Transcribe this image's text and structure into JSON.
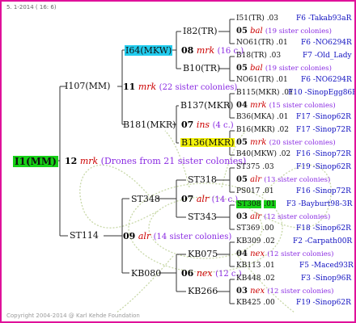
{
  "header": "5. 1-2014 ( 16: 6)",
  "copyright": "Copyright 2004-2014 @ Karl Kehde Foundation",
  "root": {
    "label": "I1(MM)",
    "bg": "#17d117"
  },
  "gen1": {
    "num": "12",
    "mrk": "mrk",
    "note": "(Drones from 21 sister colonies)"
  },
  "p1": {
    "label": "I107(MM)",
    "num": "11",
    "mrk": "mrk",
    "note": "(22 sister colonies)"
  },
  "p2": {
    "label": "ST114",
    "num": "09",
    "mrk": "alr",
    "note": "(14 sister colonies)"
  },
  "p1a": {
    "label": "I64(MKW)",
    "num": "08",
    "mrk": "mrk",
    "note": "(16 c.)",
    "bg": "#22ccee"
  },
  "p1b": {
    "label": "B181(MKR)",
    "num": "07",
    "mrk": "ins",
    "note": "(4 c.)"
  },
  "p2a": {
    "label": "ST348",
    "num": "07",
    "mrk": "alr",
    "note": "(14 c.)"
  },
  "p2b": {
    "label": "KB080",
    "num": "06",
    "mrk": "nex",
    "note": "(12 c.)"
  },
  "g3": [
    {
      "label": "I82(TR)"
    },
    {
      "label": "B10(TR)"
    },
    {
      "label": "B137(MKR)"
    },
    {
      "label": "B136(MKR)",
      "bg": "#f2f20a"
    },
    {
      "label": "ST318"
    },
    {
      "label": "ST343"
    },
    {
      "label": "KB075"
    },
    {
      "label": "KB266"
    }
  ],
  "g4": [
    {
      "top": {
        "name": "I51(TR)",
        "val": ".03",
        "code": "F6 -Takab93aR"
      },
      "mid": {
        "num": "05",
        "mrk": "bal",
        "note": "(19 sister colonies)"
      },
      "bot": {
        "name": "NO61(TR)",
        "val": ".01",
        "code": "F6 -NO6294R"
      }
    },
    {
      "top": {
        "name": "B18(TR)",
        "val": ".03",
        "code": "F7 -Old_Lady"
      },
      "mid": {
        "num": "05",
        "mrk": "bal",
        "note": "(19 sister colonies)"
      },
      "bot": {
        "name": "NO61(TR)",
        "val": ".01",
        "code": "F6 -NO6294R"
      }
    },
    {
      "top": {
        "name": "B115(MKR)",
        "val": ".01",
        "code": "F10 -SinopEgg86R"
      },
      "mid": {
        "num": "04",
        "mrk": "mrk",
        "note": "(15 sister colonies)"
      },
      "bot": {
        "name": "B36(MKA)",
        "val": ".01",
        "code": "F17 -Sinop62R"
      }
    },
    {
      "top": {
        "name": "B16(MKR)",
        "val": ".02",
        "code": "F17 -Sinop72R"
      },
      "mid": {
        "num": "05",
        "mrk": "mrk",
        "note": "(20 sister colonies)"
      },
      "bot": {
        "name": "B40(MKW)",
        "val": ".02",
        "code": "F16 -Sinop72R"
      }
    },
    {
      "top": {
        "name": "ST375",
        "val": ".03",
        "code": "F19 -Sinop62R"
      },
      "mid": {
        "num": "05",
        "mrk": "alr",
        "note": "(13 sister colonies)"
      },
      "bot": {
        "name": "PS017",
        "val": ".01",
        "code": "F16 -Sinop72R"
      }
    },
    {
      "top": {
        "name": "ST308",
        "val": ".01",
        "code": "F3 -Bayburt98-3R",
        "bg": "#17d117"
      },
      "mid": {
        "num": "03",
        "mrk": "alr",
        "note": "(12 sister colonies)"
      },
      "bot": {
        "name": "ST369",
        "val": ".00",
        "code": "F18 -Sinop62R"
      }
    },
    {
      "top": {
        "name": "KB309",
        "val": ".02",
        "code": "F2 -Carpath00R"
      },
      "mid": {
        "num": "04",
        "mrk": "nex",
        "note": "(12 sister colonies)"
      },
      "bot": {
        "name": "KB113",
        "val": ".01",
        "code": "F5 -Maced93R"
      }
    },
    {
      "top": {
        "name": "KB448",
        "val": ".02",
        "code": "F3 -Sinop96R"
      },
      "mid": {
        "num": "03",
        "mrk": "nex",
        "note": "(12 sister colonies)"
      },
      "bot": {
        "name": "KB425",
        "val": ".00",
        "code": "F19 -Sinop62R"
      }
    }
  ]
}
